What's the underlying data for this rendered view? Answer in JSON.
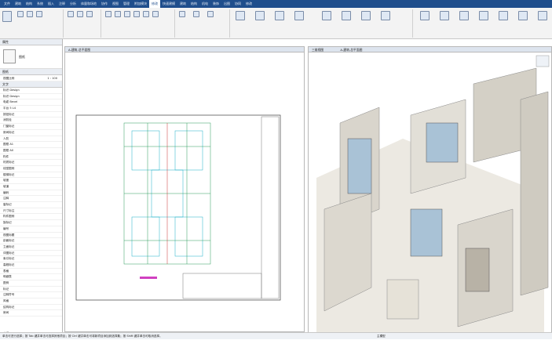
{
  "ribbon_tabs": [
    "文件",
    "建筑",
    "结构",
    "系统",
    "插入",
    "注释",
    "分析",
    "体量和场地",
    "协作",
    "视图",
    "管理",
    "附加模块",
    "修改",
    "快速建模",
    "建筑",
    "结构",
    "机电",
    "装饰",
    "出图",
    "协同",
    "修改"
  ],
  "left_panel": {
    "properties_title": "属性",
    "type_selector": "图纸",
    "view_label": "图纸",
    "sheet_label": "视图比例",
    "scale_value": "1 : 100",
    "section_label": "文字",
    "items": [
      "标识 Design",
      "标识 Design",
      "电缆 Bevel",
      "平台 5 L4",
      "按钮标记",
      "消防栓",
      "门窗标记",
      "房间标记",
      "人防",
      "图框 A1",
      "图框 A0",
      "构件",
      "材质标记",
      "线型图例",
      "楼梯标记",
      "坡度",
      "坡道",
      "编码",
      "注释",
      "窗标记",
      "尺寸标注",
      "构件图例",
      "族标记",
      "编号",
      "视图标题",
      "剖面标记",
      "立面标记",
      "详图标记",
      "索引标记",
      "高程标记",
      "表格",
      "明细表",
      "图例",
      "标记",
      "注释符号",
      "风格",
      "结构标记",
      "房间"
    ],
    "apply_label": "应用"
  },
  "views": {
    "sheet_title": "A-建筑-总平面图",
    "model_title": "三维视图",
    "model_title2": "A-建筑-总平面图"
  },
  "status_bar": {
    "text": "单击可进行选择；按 Tab 键并单击可选择其他项目；按 Ctrl 键并单击可将新项目添加到选择集；按 Shift 键并单击可取消选择。",
    "model_value": "主模型"
  },
  "colors": {
    "tabbar": "#1f4e8c",
    "drawing": "#2a9a5a",
    "drawing_cyan": "#1ab0c8",
    "wall": "#e9e6de"
  }
}
